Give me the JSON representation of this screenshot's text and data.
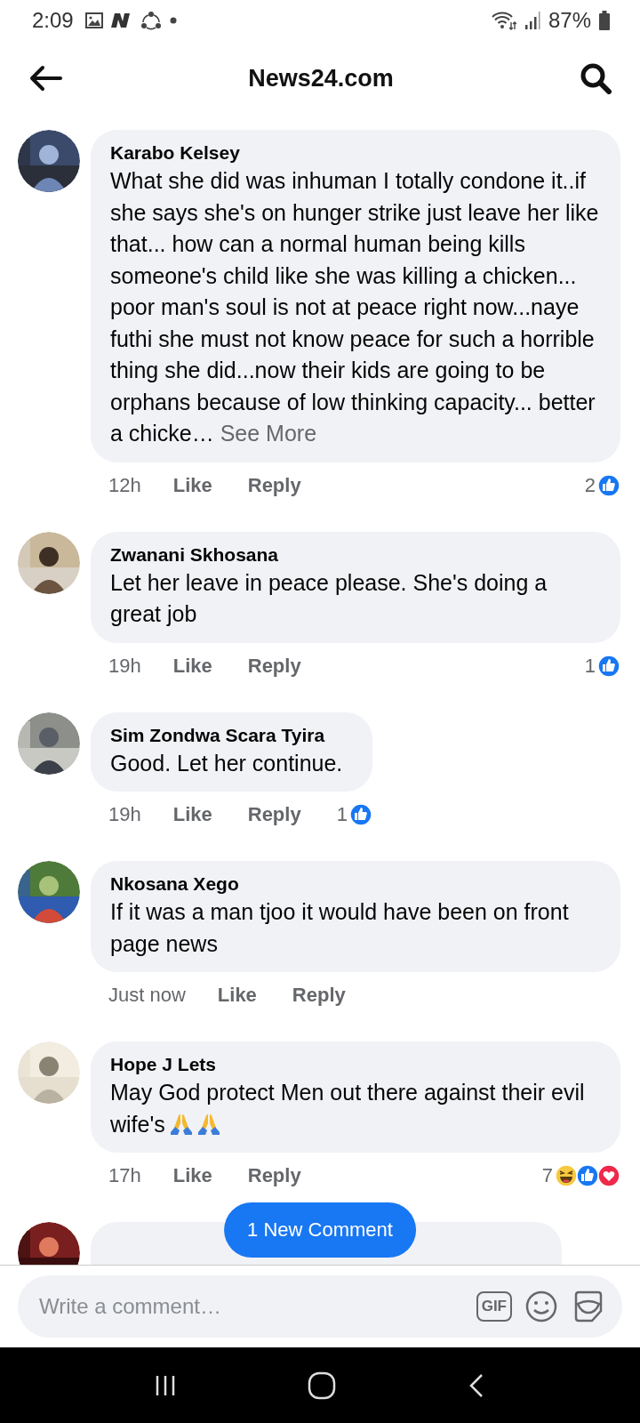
{
  "status_bar": {
    "time": "2:09",
    "battery": "87%"
  },
  "header": {
    "title": "News24.com"
  },
  "comments": [
    {
      "name": "Karabo Kelsey",
      "text": "What she did was inhuman I totally condone it..if she says she's on hunger strike just leave her like that... how can a normal human being kills someone's child like she was killing a chicken... poor man's soul is not at peace right now...naye futhi she must not know peace for such a horrible thing she did...now their kids are going to be orphans because of low thinking capacity... better a chicke…",
      "see_more": "See More",
      "time": "12h",
      "like": "Like",
      "reply": "Reply",
      "reactions": {
        "count": "2",
        "icons": [
          {
            "kind": "like"
          }
        ]
      }
    },
    {
      "name": "Zwanani Skhosana",
      "text": "Let her leave in peace please. She's doing a great job",
      "time": "19h",
      "like": "Like",
      "reply": "Reply",
      "reactions": {
        "count": "1",
        "icons": [
          {
            "kind": "like"
          }
        ]
      }
    },
    {
      "name": "Sim Zondwa Scara Tyira",
      "text": "Good. Let her continue.",
      "time": "19h",
      "like": "Like",
      "reply": "Reply",
      "reactions": {
        "count": "1",
        "icons": [
          {
            "kind": "like"
          }
        ]
      }
    },
    {
      "name": "Nkosana Xego",
      "text": "If it was a man tjoo it would have been on front page news",
      "time": "Just now",
      "like": "Like",
      "reply": "Reply"
    },
    {
      "name": "Hope J Lets",
      "text": "May God protect Men out there against their evil wife's",
      "emoji": [
        {
          "kind": "pray"
        },
        {
          "kind": "pray"
        }
      ],
      "time": "17h",
      "like": "Like",
      "reply": "Reply",
      "reactions": {
        "count": "7",
        "icons": [
          {
            "kind": "haha"
          },
          {
            "kind": "like"
          },
          {
            "kind": "love"
          }
        ]
      }
    },
    {
      "kind": "partial"
    }
  ],
  "new_comments_button": "1 New Comment",
  "composer": {
    "placeholder": "Write a comment…",
    "gif": "GIF"
  }
}
